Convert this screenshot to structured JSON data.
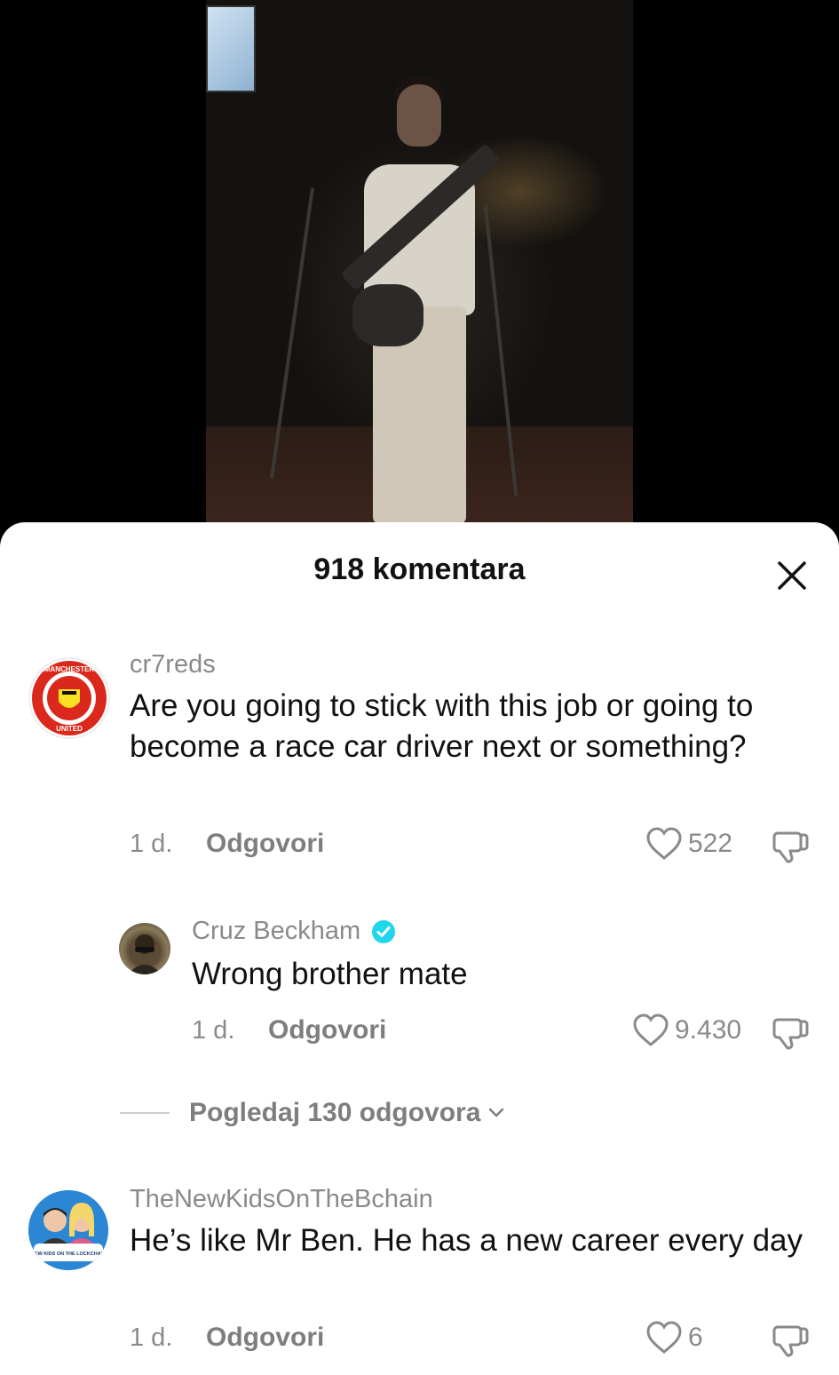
{
  "sheet": {
    "title": "918 komentara",
    "close_icon": "close-icon"
  },
  "comments": [
    {
      "username": "cr7reds",
      "text": "Are you going to stick with this job or going to become a race car driver next or something?",
      "time": "1 d.",
      "reply_label": "Odgovori",
      "likes": "522",
      "avatar": "manchester-united-crest",
      "avatar_text_top": "MANCHESTER",
      "avatar_text_bottom": "UNITED"
    },
    {
      "username": "Cruz Beckham",
      "verified": true,
      "text": "Wrong brother mate",
      "time": "1 d.",
      "reply_label": "Odgovori",
      "likes": "9.430",
      "avatar": "user-photo"
    },
    {
      "username": "TheNewKidsOnTheBchain",
      "text": "He’s like Mr Ben. He has a new career every day",
      "time": "1 d.",
      "reply_label": "Odgovori",
      "likes": "6",
      "avatar": "cartoon-duo-logo",
      "avatar_text": "NEW KIDS ON THE LOCKCHAIN"
    }
  ],
  "view_replies": {
    "label": "Pogledaj 130 odgovora"
  },
  "colors": {
    "sheet_bg": "#ffffff",
    "muted_text": "#8a8a8a",
    "verified": "#20d5ec",
    "man_utd_red": "#da291c"
  }
}
